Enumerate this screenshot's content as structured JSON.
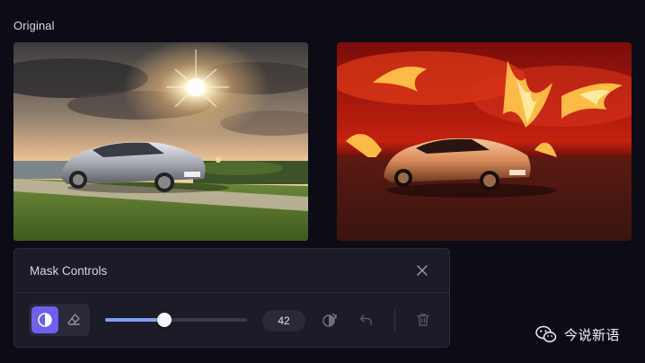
{
  "labels": {
    "original": "Original"
  },
  "images": {
    "original": {
      "alt": "Silver sports car at sunset by the sea"
    },
    "edited": {
      "alt": "Sports car surrounded by fire"
    }
  },
  "mask_controls": {
    "title": "Mask Controls",
    "close_icon": "close-icon",
    "tools": [
      {
        "name": "mask-invert-toggle",
        "icon": "half-circle-icon",
        "active": true
      },
      {
        "name": "eraser",
        "icon": "eraser-icon",
        "active": false
      }
    ],
    "brush_size": {
      "value": "42",
      "fraction": 0.42
    },
    "actions": [
      {
        "name": "invert-mask",
        "icon": "rotate-invert-icon"
      },
      {
        "name": "undo",
        "icon": "undo-icon"
      },
      {
        "name": "delete",
        "icon": "trash-icon"
      }
    ],
    "colors": {
      "accent": "#6d5ff0",
      "slider_fill": "#7e9ef3",
      "panel": "#1c1b28"
    }
  },
  "watermark": {
    "text": "今说新语",
    "icon": "wechat-icon"
  }
}
